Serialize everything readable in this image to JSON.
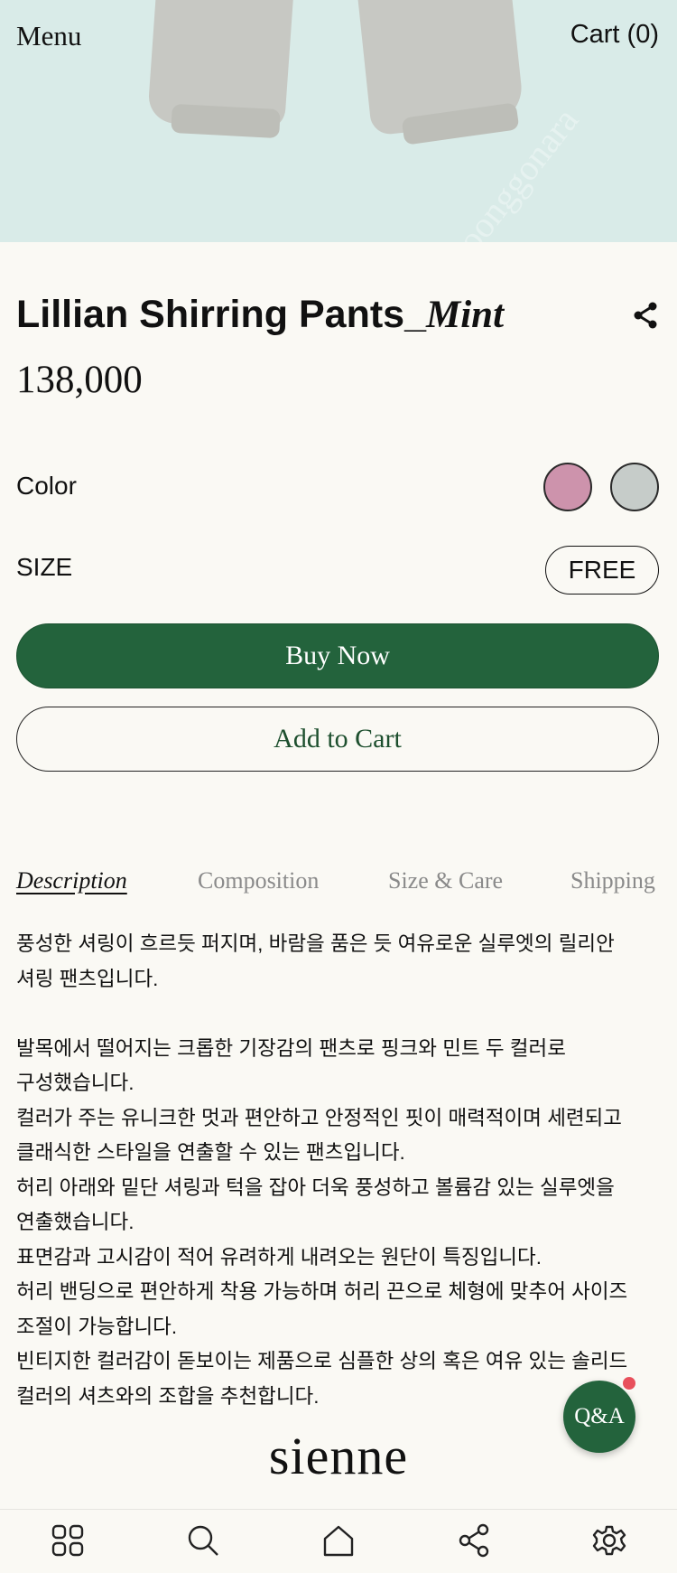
{
  "header": {
    "menu_label": "Menu",
    "cart_label": "Cart (0)"
  },
  "hero": {
    "watermark": "joonggonara"
  },
  "product": {
    "name": "Lillian Shirring Pants_",
    "color_name": "Mint",
    "price": "138,000",
    "share_icon": "share-icon"
  },
  "options": {
    "color_label": "Color",
    "swatches": [
      {
        "name": "pink",
        "hex": "#cd93ac"
      },
      {
        "name": "mint",
        "hex": "#c6ccc9"
      }
    ],
    "size_label": "SIZE",
    "size_value": "FREE"
  },
  "actions": {
    "buy_label": "Buy Now",
    "cart_label": "Add to Cart"
  },
  "tabs": [
    {
      "label": "Description",
      "active": true
    },
    {
      "label": "Composition",
      "active": false
    },
    {
      "label": "Size & Care",
      "active": false
    },
    {
      "label": "Shipping",
      "active": false
    }
  ],
  "description": {
    "lines": [
      "풍성한 셔링이 흐르듯 퍼지며, 바람을 품은 듯 여유로운 실루엣의 릴리안",
      "셔링 팬츠입니다.",
      "",
      "발목에서 떨어지는 크롭한 기장감의 팬츠로 핑크와 민트 두 컬러로",
      "구성했습니다.",
      "컬러가 주는 유니크한 멋과 편안하고 안정적인 핏이 매력적이며 세련되고",
      "클래식한 스타일을 연출할 수 있는 팬츠입니다.",
      "허리 아래와 밑단 셔링과 턱을 잡아 더욱 풍성하고 볼륨감 있는 실루엣을",
      "연출했습니다.",
      "표면감과 고시감이 적어 유려하게 내려오는 원단이 특징입니다.",
      "허리 밴딩으로 편안하게 착용 가능하며 허리 끈으로 체형에 맞추어 사이즈",
      "조절이 가능합니다.",
      "빈티지한 컬러감이 돋보이는 제품으로 심플한 상의 혹은 여유 있는 솔리드",
      "컬러의 셔츠와의 조합을 추천합니다."
    ]
  },
  "brand": {
    "logo": "sienne"
  },
  "qa": {
    "label": "Q&A"
  },
  "bottom_nav": [
    {
      "icon": "grid-icon"
    },
    {
      "icon": "search-icon"
    },
    {
      "icon": "home-icon"
    },
    {
      "icon": "share-icon"
    },
    {
      "icon": "gear-icon"
    }
  ],
  "colors": {
    "accent": "#23633c",
    "background": "#faf9f4",
    "notification": "#e8505b"
  }
}
